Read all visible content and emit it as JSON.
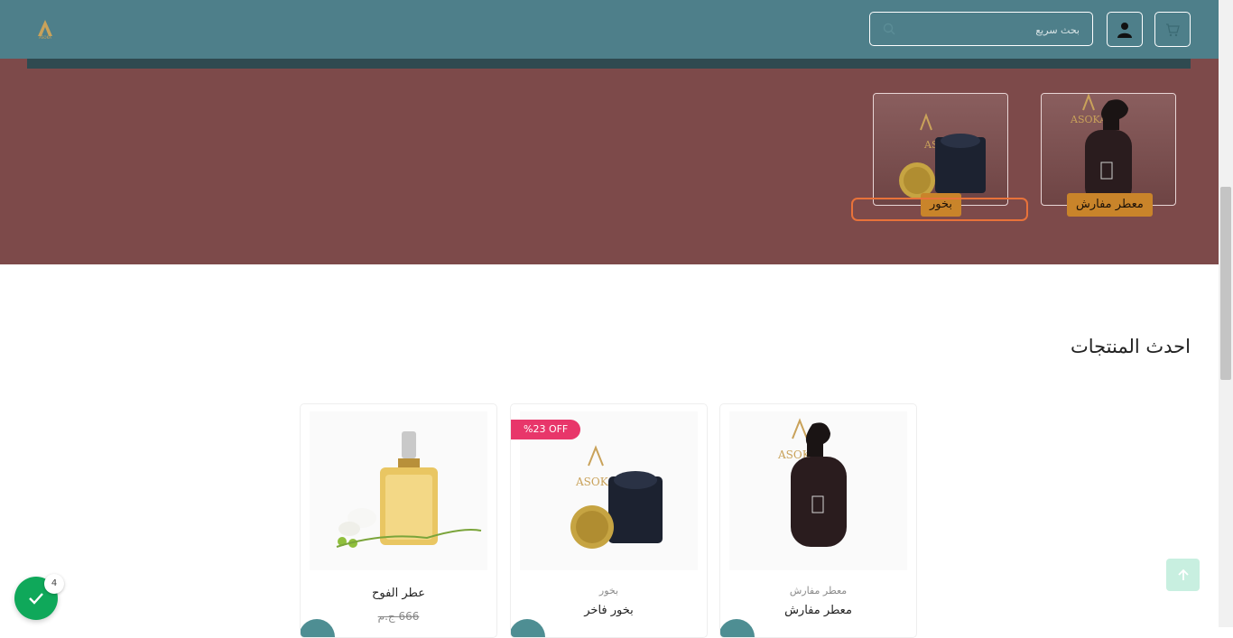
{
  "header": {
    "logo_text": "ASOKA",
    "search_placeholder": "بحث سريع",
    "user_icon": "user-icon",
    "cart_icon": "cart-icon",
    "search_icon": "search-icon"
  },
  "categories": [
    {
      "label": "معطر مفارش",
      "brand_text": "ASOKA"
    },
    {
      "label": "بخور",
      "brand_text": "ASOKA"
    }
  ],
  "latest": {
    "title": "احدث المنتجات",
    "products": [
      {
        "category": "معطر مفارش",
        "name": "معطر مفارش",
        "brand_text": "ASOKA"
      },
      {
        "category": "بخور",
        "name": "بخور فاخر",
        "badge": "%23 OFF",
        "brand_text": "ASOKA"
      },
      {
        "name": "عطر الفوح",
        "old_price": "666 ج.م"
      }
    ]
  },
  "floating": {
    "notif_count": "4",
    "to_top_icon": "arrow-up-icon",
    "check_icon": "check-icon"
  },
  "colors": {
    "header": "#4e7f8a",
    "hero": "#7d4a4a",
    "label": "#c9842a",
    "badge": "#e8366a",
    "notif": "#0fa85a"
  }
}
